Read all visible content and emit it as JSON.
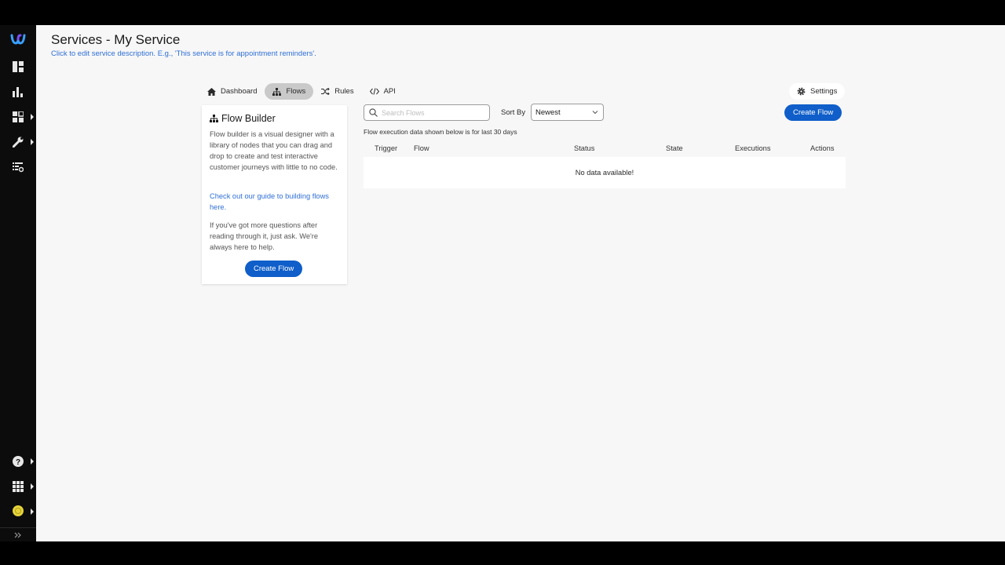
{
  "sidebar": {
    "items": [
      {
        "icon": "webex-logo-icon"
      },
      {
        "icon": "dashboard-icon"
      },
      {
        "icon": "bar-chart-icon"
      },
      {
        "icon": "widgets-icon",
        "caret": true
      },
      {
        "icon": "wrench-icon",
        "caret": true
      },
      {
        "icon": "list-settings-icon"
      }
    ],
    "bottom": [
      {
        "icon": "help-icon",
        "caret": true
      },
      {
        "icon": "apps-grid-icon",
        "caret": true
      },
      {
        "icon": "avatar-icon",
        "caret": true,
        "color": "#e5d33a"
      }
    ],
    "expand_icon": "double-chevron-right-icon"
  },
  "header": {
    "title": "Services - My Service",
    "description": "Click to edit service description. E.g., 'This service is for appointment reminders'."
  },
  "tabs": [
    {
      "label": "Dashboard",
      "icon": "home-icon",
      "active": false
    },
    {
      "label": "Flows",
      "icon": "flow-tree-icon",
      "active": true
    },
    {
      "label": "Rules",
      "icon": "shuffle-icon",
      "active": false
    },
    {
      "label": "API",
      "icon": "code-icon",
      "active": false
    }
  ],
  "settings": {
    "label": "Settings",
    "icon": "gear-icon"
  },
  "info_card": {
    "title": "Flow Builder",
    "paragraph1": "Flow builder is a visual designer with a library of nodes that you can drag and drop to create and test interactive customer journeys with little to no code.",
    "link_text": "Check out our guide to building flows here.",
    "paragraph2": "If you've got more questions after reading through it, just ask. We're always here to help.",
    "button": "Create Flow"
  },
  "toolbar": {
    "search_placeholder": "Search Flows",
    "sort_label": "Sort By",
    "sort_value": "Newest",
    "create_button": "Create Flow"
  },
  "exec_note": "Flow execution data shown below is for last 30 days",
  "table": {
    "columns": [
      "Trigger",
      "Flow",
      "Status",
      "State",
      "Executions",
      "Actions"
    ],
    "empty_message": "No data available!"
  },
  "colors": {
    "accent": "#0f5ec9",
    "link": "#2f6fd6",
    "sidebar_bg": "#0c0c0c",
    "main_bg": "#f7f7f7"
  }
}
